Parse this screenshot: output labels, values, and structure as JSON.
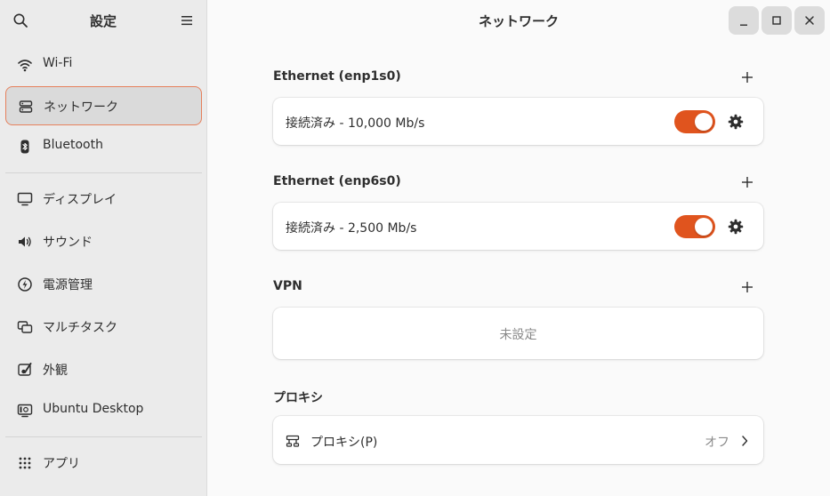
{
  "sidebar": {
    "title": "設定",
    "icons": {
      "search": "search-icon",
      "menu": "hamburger-menu-icon"
    },
    "items": [
      {
        "label": "Wi-Fi",
        "icon": "wifi-icon"
      },
      {
        "label": "ネットワーク",
        "icon": "network-icon",
        "active": true
      },
      {
        "label": "Bluetooth",
        "icon": "bluetooth-icon"
      },
      {
        "label": "ディスプレイ",
        "icon": "display-icon"
      },
      {
        "label": "サウンド",
        "icon": "speaker-icon"
      },
      {
        "label": "電源管理",
        "icon": "power-icon"
      },
      {
        "label": "マルチタスク",
        "icon": "multitasking-icon"
      },
      {
        "label": "外観",
        "icon": "appearance-icon"
      },
      {
        "label": "Ubuntu Desktop",
        "icon": "ubuntu-desktop-icon"
      },
      {
        "label": "アプリ",
        "icon": "apps-grid-icon"
      }
    ]
  },
  "main": {
    "title": "ネットワーク",
    "window_controls": [
      "minimize-icon",
      "maximize-icon",
      "close-icon"
    ],
    "sections": {
      "eth1": {
        "title": "Ethernet (enp1s0)",
        "status": "接続済み - 10,000 Mb/s",
        "enabled": true
      },
      "eth2": {
        "title": "Ethernet (enp6s0)",
        "status": "接続済み - 2,500 Mb/s",
        "enabled": true
      },
      "vpn": {
        "title": "VPN",
        "placeholder": "未設定"
      },
      "proxy": {
        "title": "プロキシ",
        "label": "プロキシ(P)",
        "value": "オフ"
      }
    }
  },
  "colors": {
    "accent": "#e0541e",
    "active_outline": "#e6805c",
    "sidebar_bg": "#ebebeb",
    "content_bg": "#fafafa"
  }
}
